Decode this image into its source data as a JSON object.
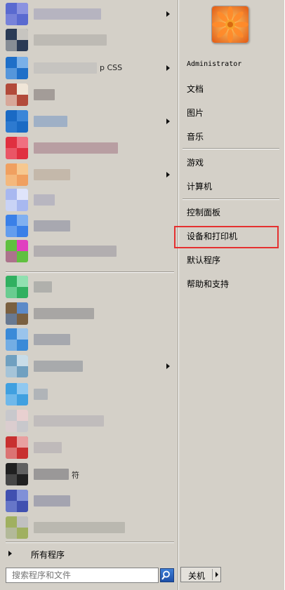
{
  "start_menu": {
    "programs": [
      {
        "name": "program-1",
        "colors": [
          "#5a6ad0",
          "#8a92e0"
        ],
        "label_color": "#b6b4c0",
        "label_text": "",
        "has_submenu": true
      },
      {
        "name": "program-2",
        "colors": [
          "#2a3a55",
          "#c7c5c0"
        ],
        "label_color": "#bdbab4",
        "label_text": "",
        "has_submenu": false
      },
      {
        "name": "program-3",
        "colors": [
          "#1f6fc8",
          "#7ab0e8"
        ],
        "label_color": "#c6c4c0",
        "label_text": "p CSS",
        "has_submenu": true
      },
      {
        "name": "program-4",
        "colors": [
          "#b24a3a",
          "#f0e6d8"
        ],
        "label_color": "#a39c98",
        "label_text": "",
        "has_submenu": false
      },
      {
        "name": "program-5",
        "colors": [
          "#1a6ac4",
          "#3b86d8"
        ],
        "label_color": "#9fb0c6",
        "label_text": "",
        "has_submenu": true
      },
      {
        "name": "program-6",
        "colors": [
          "#e03040",
          "#f07080"
        ],
        "label_color": "#b89ea2",
        "label_text": "",
        "has_submenu": false
      },
      {
        "name": "program-7",
        "colors": [
          "#f0a060",
          "#f6c890"
        ],
        "label_color": "#c4b8aa",
        "label_text": "",
        "has_submenu": true
      },
      {
        "name": "program-8",
        "colors": [
          "#a8b8f0",
          "#dfe4fa"
        ],
        "label_color": "#b8b6c0",
        "label_text": "",
        "has_submenu": false
      },
      {
        "name": "program-9",
        "colors": [
          "#3a80e8",
          "#80b0f0"
        ],
        "label_color": "#a8a8b0",
        "label_text": "",
        "has_submenu": false
      },
      {
        "name": "program-10",
        "colors": [
          "#60c040",
          "#e040c0"
        ],
        "label_color": "#b2aeb0",
        "label_text": "",
        "has_submenu": false
      },
      {
        "name": "program-11",
        "colors": [
          "#30b060",
          "#90e0b0"
        ],
        "label_color": "#b0b0ac",
        "label_text": "",
        "has_submenu": false
      },
      {
        "name": "program-12",
        "colors": [
          "#7a6040",
          "#5c8ac8"
        ],
        "label_color": "#a8a6a4",
        "label_text": "",
        "has_submenu": false
      },
      {
        "name": "program-13",
        "colors": [
          "#3a8ad8",
          "#9ac4ec"
        ],
        "label_color": "#a6a8ae",
        "label_text": "",
        "has_submenu": false
      },
      {
        "name": "program-14",
        "colors": [
          "#70a0c0",
          "#c8dce8"
        ],
        "label_color": "#a8aaac",
        "label_text": "",
        "has_submenu": true
      },
      {
        "name": "program-15",
        "colors": [
          "#40a0e0",
          "#90c8f0"
        ],
        "label_color": "#b0b4b8",
        "label_text": "",
        "has_submenu": false
      },
      {
        "name": "program-16",
        "colors": [
          "#c8c8cc",
          "#e8d0d0"
        ],
        "label_color": "#c0bcbc",
        "label_text": "",
        "has_submenu": false
      },
      {
        "name": "program-17",
        "colors": [
          "#c83030",
          "#e8a0a0"
        ],
        "label_color": "#bfbaba",
        "label_text": "",
        "has_submenu": false
      },
      {
        "name": "program-18",
        "colors": [
          "#202020",
          "#606060"
        ],
        "label_color": "#9a9898",
        "label_text": "符",
        "has_submenu": false
      },
      {
        "name": "program-19",
        "colors": [
          "#4050b0",
          "#8090d8"
        ],
        "label_color": "#a4a4b0",
        "label_text": "",
        "has_submenu": false
      },
      {
        "name": "program-20",
        "colors": [
          "#a0b060",
          "#c0c0c0"
        ],
        "label_color": "#bab8b0",
        "label_text": "",
        "has_submenu": false
      }
    ],
    "all_programs_label": "所有程序",
    "search": {
      "placeholder": "搜索程序和文件"
    },
    "user_name": "Administrator",
    "right_items": [
      {
        "label": "文档"
      },
      {
        "label": "图片"
      },
      {
        "label": "音乐"
      },
      {
        "label": "游戏"
      },
      {
        "label": "计算机"
      },
      {
        "label": "控制面板"
      },
      {
        "label": "设备和打印机"
      },
      {
        "label": "默认程序"
      },
      {
        "label": "帮助和支持"
      }
    ],
    "shutdown_label": "关机",
    "highlight_color": "#e53030"
  }
}
